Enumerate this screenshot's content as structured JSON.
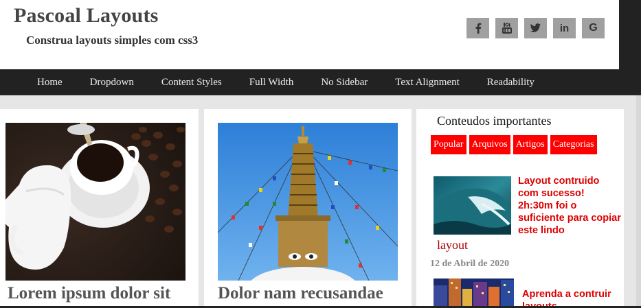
{
  "site": {
    "title": "Pascoal Layouts",
    "tagline": "Construa layouts simples com css3"
  },
  "social": [
    {
      "icon": "facebook-icon",
      "glyph": "f"
    },
    {
      "icon": "youtube-icon",
      "glyph": "▶"
    },
    {
      "icon": "twitter-icon",
      "glyph": "🐦"
    },
    {
      "icon": "linkedin-icon",
      "glyph": "in"
    },
    {
      "icon": "google-icon",
      "glyph": "G"
    }
  ],
  "nav": {
    "items": [
      "Home",
      "Dropdown",
      "Content Styles",
      "Full Width",
      "No Sidebar",
      "Text Alignment",
      "Readability"
    ]
  },
  "cards": [
    {
      "title": "Lorem ipsum dolor sit",
      "image": "coffee-cup-image"
    },
    {
      "title": "Dolor nam recusandae",
      "image": "stupa-prayer-flags-image"
    }
  ],
  "sidebar": {
    "widget_title": "Conteudos importantes",
    "tabs": [
      "Popular",
      "Arquivos",
      "Artigos",
      "Categorias"
    ],
    "posts": [
      {
        "text": "Layout contruido com sucesso! 2h:30m foi o suficiente para copiar este lindo",
        "tail": "layout",
        "date": "12 de Abril de 2020",
        "image": "ocean-wave-image"
      },
      {
        "text": "Aprenda a contruir layouts",
        "image": "city-night-image"
      }
    ]
  },
  "colors": {
    "nav_bg": "#222222",
    "accent_red": "#ff0000",
    "page_bg": "#e6e6e6",
    "social_bg": "#a0a0a0"
  }
}
